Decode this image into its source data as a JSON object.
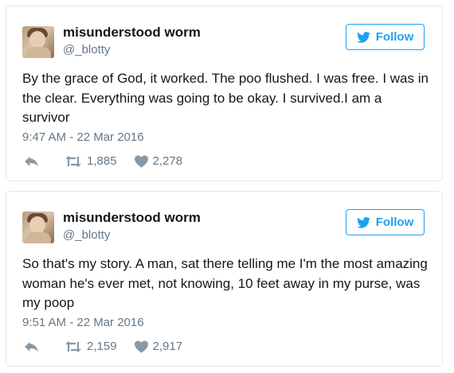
{
  "colors": {
    "accent": "#1da1f2",
    "secondary_text": "#657786",
    "primary_text": "#14171a",
    "border": "#e1e8ed"
  },
  "tweets": [
    {
      "name": "misunderstood worm",
      "handle": "@_blotty",
      "follow_label": "Follow",
      "text": "By the grace of God, it worked. The poo flushed. I was free. I was in the clear. Everything was going to be okay. I survived.I am a survivor",
      "timestamp": "9:47 AM - 22 Mar 2016",
      "retweets": "1,885",
      "likes": "2,278",
      "icons": [
        "twitter-bird-icon",
        "reply-icon",
        "retweet-icon",
        "heart-icon"
      ]
    },
    {
      "name": "misunderstood worm",
      "handle": "@_blotty",
      "follow_label": "Follow",
      "text": "So that's my story. A man, sat there telling me I'm the most amazing woman he's ever met, not knowing, 10 feet away in my purse, was my poop",
      "timestamp": "9:51 AM - 22 Mar 2016",
      "retweets": "2,159",
      "likes": "2,917",
      "icons": [
        "twitter-bird-icon",
        "reply-icon",
        "retweet-icon",
        "heart-icon"
      ]
    }
  ]
}
